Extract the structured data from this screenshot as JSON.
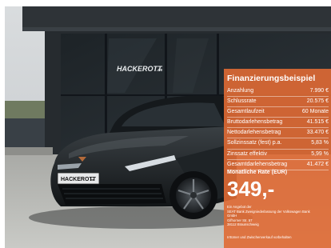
{
  "colors": {
    "panel": "#e06a34",
    "building": "#2d3236",
    "car": "#1b1f22",
    "ground": "#b7b8b4"
  },
  "photo": {
    "building_sign": "HACKEROTT",
    "building_sign_suffix": ".de",
    "plate": "HACKEROTT",
    "plate_suffix": ".de"
  },
  "finance": {
    "title": "Finanzierungsbeispiel",
    "rows": [
      {
        "label": "Anzahlung",
        "value": "7.990 €"
      },
      {
        "label": "Schlussrate",
        "value": "20.575 €"
      },
      {
        "label": "Gesamtlaufzeit",
        "value": "60 Monate"
      },
      {
        "label": "Bruttodarlehensbetrag",
        "value": "41.515 €"
      },
      {
        "label": "Nettodarlehensbetrag",
        "value": "33.470 €"
      },
      {
        "label": "Sollzinssatz (fest) p.a.",
        "value": "5,83 %"
      },
      {
        "label": "Zinssatz effektiv",
        "value": "5,99 %"
      },
      {
        "label": "Gesamtdarlehensbetrag",
        "value": "41.472 €"
      }
    ],
    "rate_label": "Monatliche Rate (EUR)",
    "rate_value": "349,-",
    "lender": [
      "Ein Angebot der",
      "SEAT Bank Zweigniederlassung der Volkswagen Bank",
      "GmbH",
      "Gifhorner Str. 57",
      "38112 Braunschweig"
    ],
    "footnote": "Irrtümer und Zwischenverkauf vorbehalten"
  }
}
